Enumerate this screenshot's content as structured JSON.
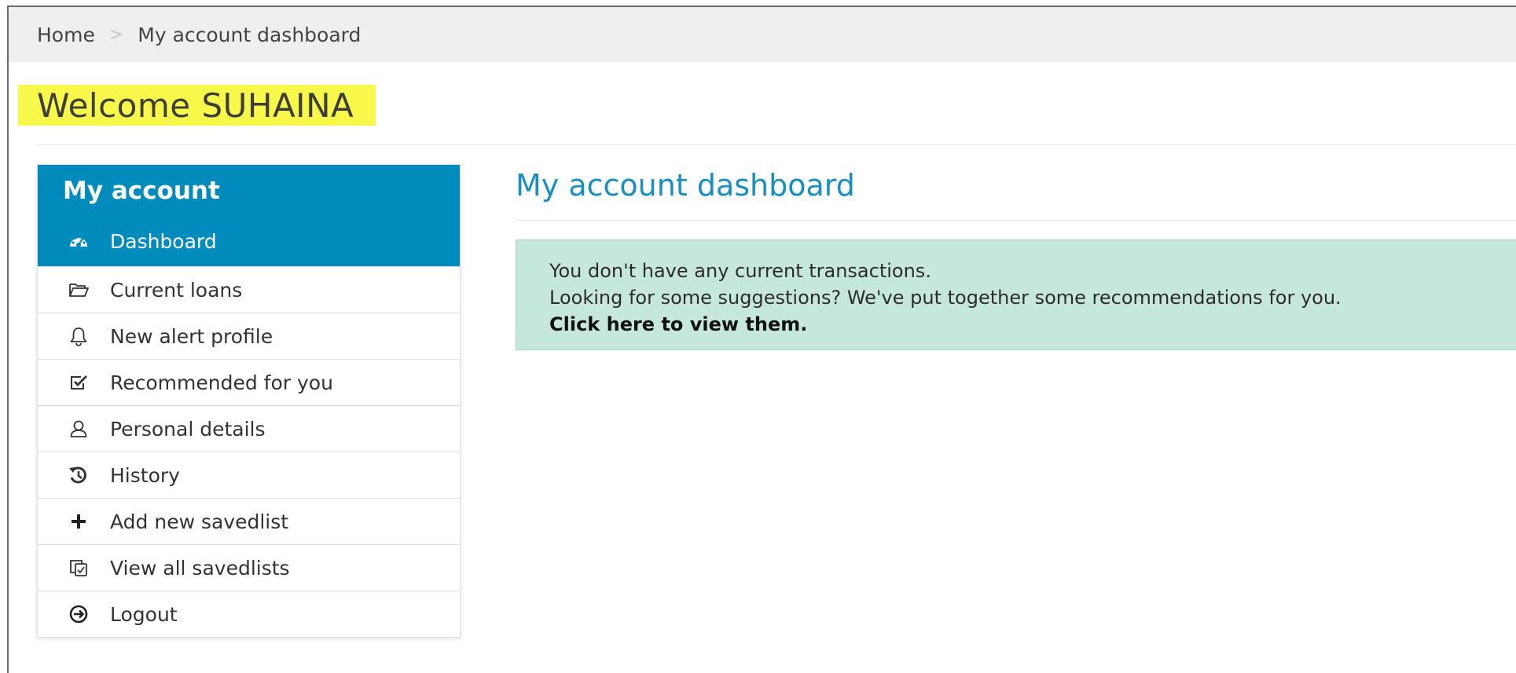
{
  "breadcrumb": {
    "home": "Home",
    "separator": ">",
    "current": "My account dashboard"
  },
  "welcome": {
    "text": "Welcome SUHAINA",
    "highlight_color": "#f8f84a"
  },
  "sidebar": {
    "header": "My account",
    "accent_color": "#008bbd",
    "items": [
      {
        "label": "Dashboard",
        "icon": "dashboard-icon",
        "active": true
      },
      {
        "label": "Current loans",
        "icon": "folder-open-icon"
      },
      {
        "label": "New alert profile",
        "icon": "bell-icon"
      },
      {
        "label": "Recommended for you",
        "icon": "check-square-icon"
      },
      {
        "label": "Personal details",
        "icon": "user-icon"
      },
      {
        "label": "History",
        "icon": "history-icon"
      },
      {
        "label": "Add new savedlist",
        "icon": "plus-icon"
      },
      {
        "label": "View all savedlists",
        "icon": "copy-icon"
      },
      {
        "label": "Logout",
        "icon": "logout-icon"
      }
    ]
  },
  "main": {
    "title": "My account dashboard",
    "title_color": "#1a8fbf",
    "alert": {
      "line1": "You don't have any current transactions.",
      "line2": "Looking for some suggestions? We've put together some recommendations for you.",
      "link": "Click here to view them.",
      "background": "#c6e8dc"
    }
  }
}
